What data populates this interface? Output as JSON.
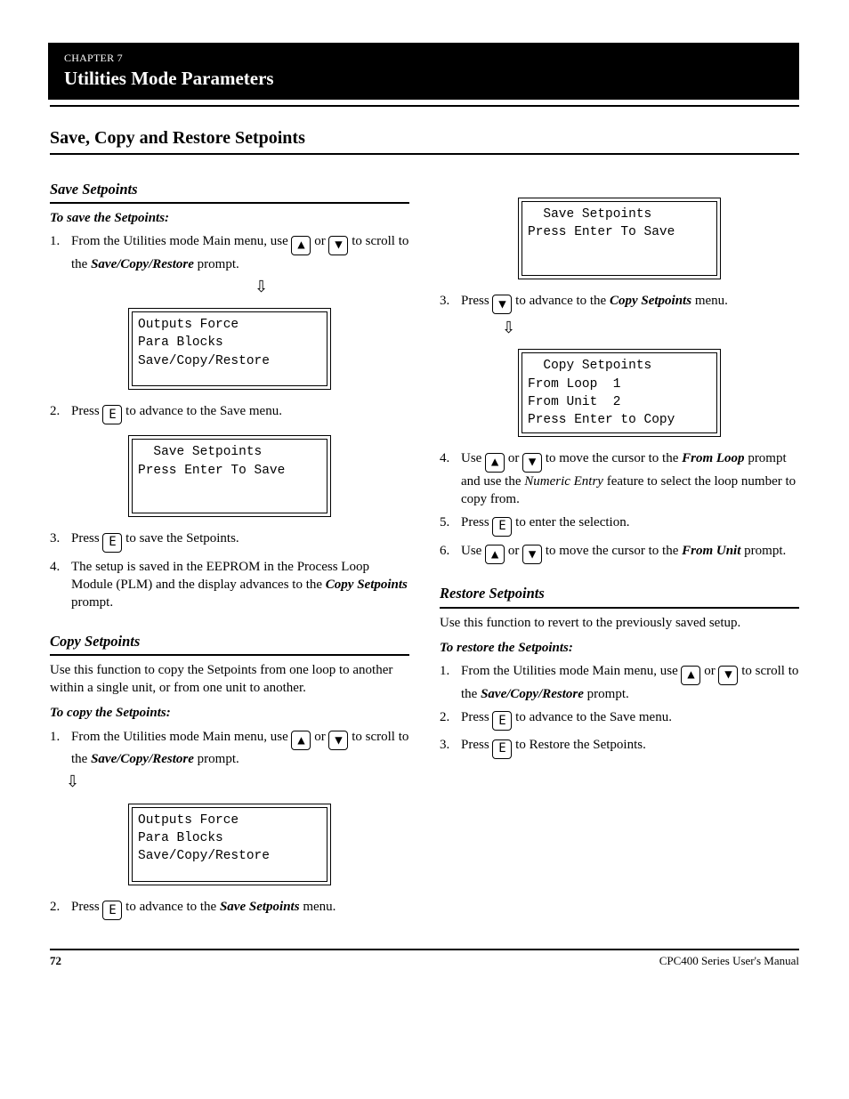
{
  "chapter": {
    "kicker": "CHAPTER 7",
    "title": "Utilities Mode Parameters"
  },
  "h1": "Save, Copy and Restore Setpoints",
  "saveH2": "Save Setpoints",
  "saveBody": {
    "h3": "To save the Setpoints:",
    "step1_num": "1.",
    "step1_pre": "From the Utilities mode Main menu, use ",
    "step1_or": " or ",
    "step1_mid": " to scroll to the ",
    "step1_item": "Save/Copy/Restore",
    "step1_post": " prompt.",
    "arrow": "⇩",
    "screen1a_l1": "Outputs Force",
    "screen1a_l2": "Para Blocks",
    "screen1a_l3": "Save/Copy/Restore",
    "step2_num": "2.",
    "step2_pre": "Press ",
    "step2_key": "E",
    "step2_post": " to advance to the Save menu.",
    "screen1b_l1": "  Save Setpoints",
    "screen1b_l2": "Press Enter To Save",
    "step3_num": "3.",
    "step3_pre": "Press ",
    "step3_key": "E",
    "step3_post": " to save the Setpoints.",
    "step4_num": "4.",
    "step4_pre": "The setup is saved in the EEPROM in the Process Loop Module (PLM) and the display advances to the ",
    "step4_item": "Copy Setpoints",
    "step4_post": " prompt."
  },
  "copyH2": "Copy Setpoints",
  "copyIntro": "Use this function to copy the Setpoints from one loop to another within a single unit, or from one unit to another.",
  "copyBody": {
    "h3": "To copy the Setpoints:",
    "step1_num": "1.",
    "step1_pre": "From the Utilities mode Main menu, use ",
    "step1_or": " or ",
    "step1_mid": " to scroll to the ",
    "step1_item": "Save/Copy/Restore",
    "step1_post": " prompt.",
    "arrow": "⇩",
    "screen2a_l1": "Outputs Force",
    "screen2a_l2": "Para Blocks",
    "screen2a_l3": "Save/Copy/Restore",
    "step2_num": "2.",
    "step2_pre": "Press ",
    "step2_key": "E",
    "step2_mid": " to advance to the ",
    "step2_item": "Save Setpoints",
    "step2_post": " menu.",
    "screen2b_l1": "  Save Setpoints",
    "screen2b_l2": "Press Enter To Save",
    "step3_num": "3.",
    "step3_pre": "Press ",
    "step3_mid": " to advance to the ",
    "step3_item": "Copy Setpoints",
    "step3_post": " menu.",
    "arrow2": "⇩",
    "screen2c_l1": "  Copy Setpoints",
    "screen2c_l2": "From Loop  1",
    "screen2c_l3": "From Unit  2",
    "screen2c_l4": "Press Enter to Copy",
    "step4_num": "4.",
    "step4_pre": "Use ",
    "step4_or": " or ",
    "step4_mid": " to move the cursor to the ",
    "step4_item": "From Loop",
    "step4_mid2": " prompt and use the ",
    "step4_ne": "Numeric Entry",
    "step4_post": " feature to select the loop number to copy from.",
    "step5_num": "5.",
    "step5_pre": "Press ",
    "step5_key": "E",
    "step5_post": " to enter the selection.",
    "step6_num": "6.",
    "step6_pre": "Use ",
    "step6_or": " or ",
    "step6_mid": " to move the cursor to the ",
    "step6_item": "From Unit",
    "step6_post": " prompt."
  },
  "h2Restore": "Restore Setpoints",
  "restoreIntro": "Use this function to revert to the previously saved setup.",
  "restoreBody": {
    "h3": "To restore the Setpoints:",
    "step1_num": "1.",
    "step1_pre": "From the Utilities mode Main menu, use ",
    "step1_or": " or ",
    "step1_mid": " to scroll to the ",
    "step1_item": "Save/Copy/Restore",
    "step1_post": " prompt.",
    "step2_num": "2.",
    "step2_pre": "Press ",
    "step2_key": "E",
    "step2_post": " to advance to the Save menu.",
    "step3_num": "3.",
    "step3_pre": "Press ",
    "step3_key": "E",
    "step3_post": " to Restore the Setpoints."
  },
  "footer": {
    "page": "72",
    "doc": "CPC400 Series User's Manual"
  }
}
